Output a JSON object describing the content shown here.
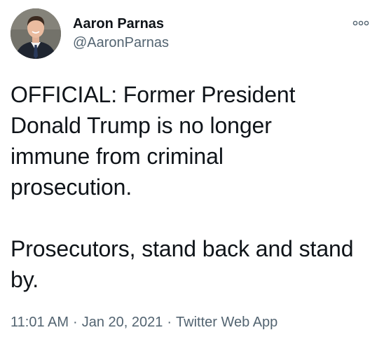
{
  "author": {
    "display_name": "Aaron Parnas",
    "handle": "@AaronParnas",
    "avatar_icon": "user-avatar-photo"
  },
  "menu": {
    "icon": "more-options-icon"
  },
  "tweet": {
    "text": "OFFICIAL: Former President\nDonald Trump is no longer\nimmune from criminal\nprosecution.\n\nProsecutors, stand back and stand\nby."
  },
  "meta": {
    "time": "11:01 AM",
    "date": "Jan 20, 2021",
    "source": "Twitter Web App",
    "separator": "·"
  },
  "colors": {
    "text_primary": "#0f1419",
    "text_secondary": "#536471",
    "background": "#ffffff"
  }
}
